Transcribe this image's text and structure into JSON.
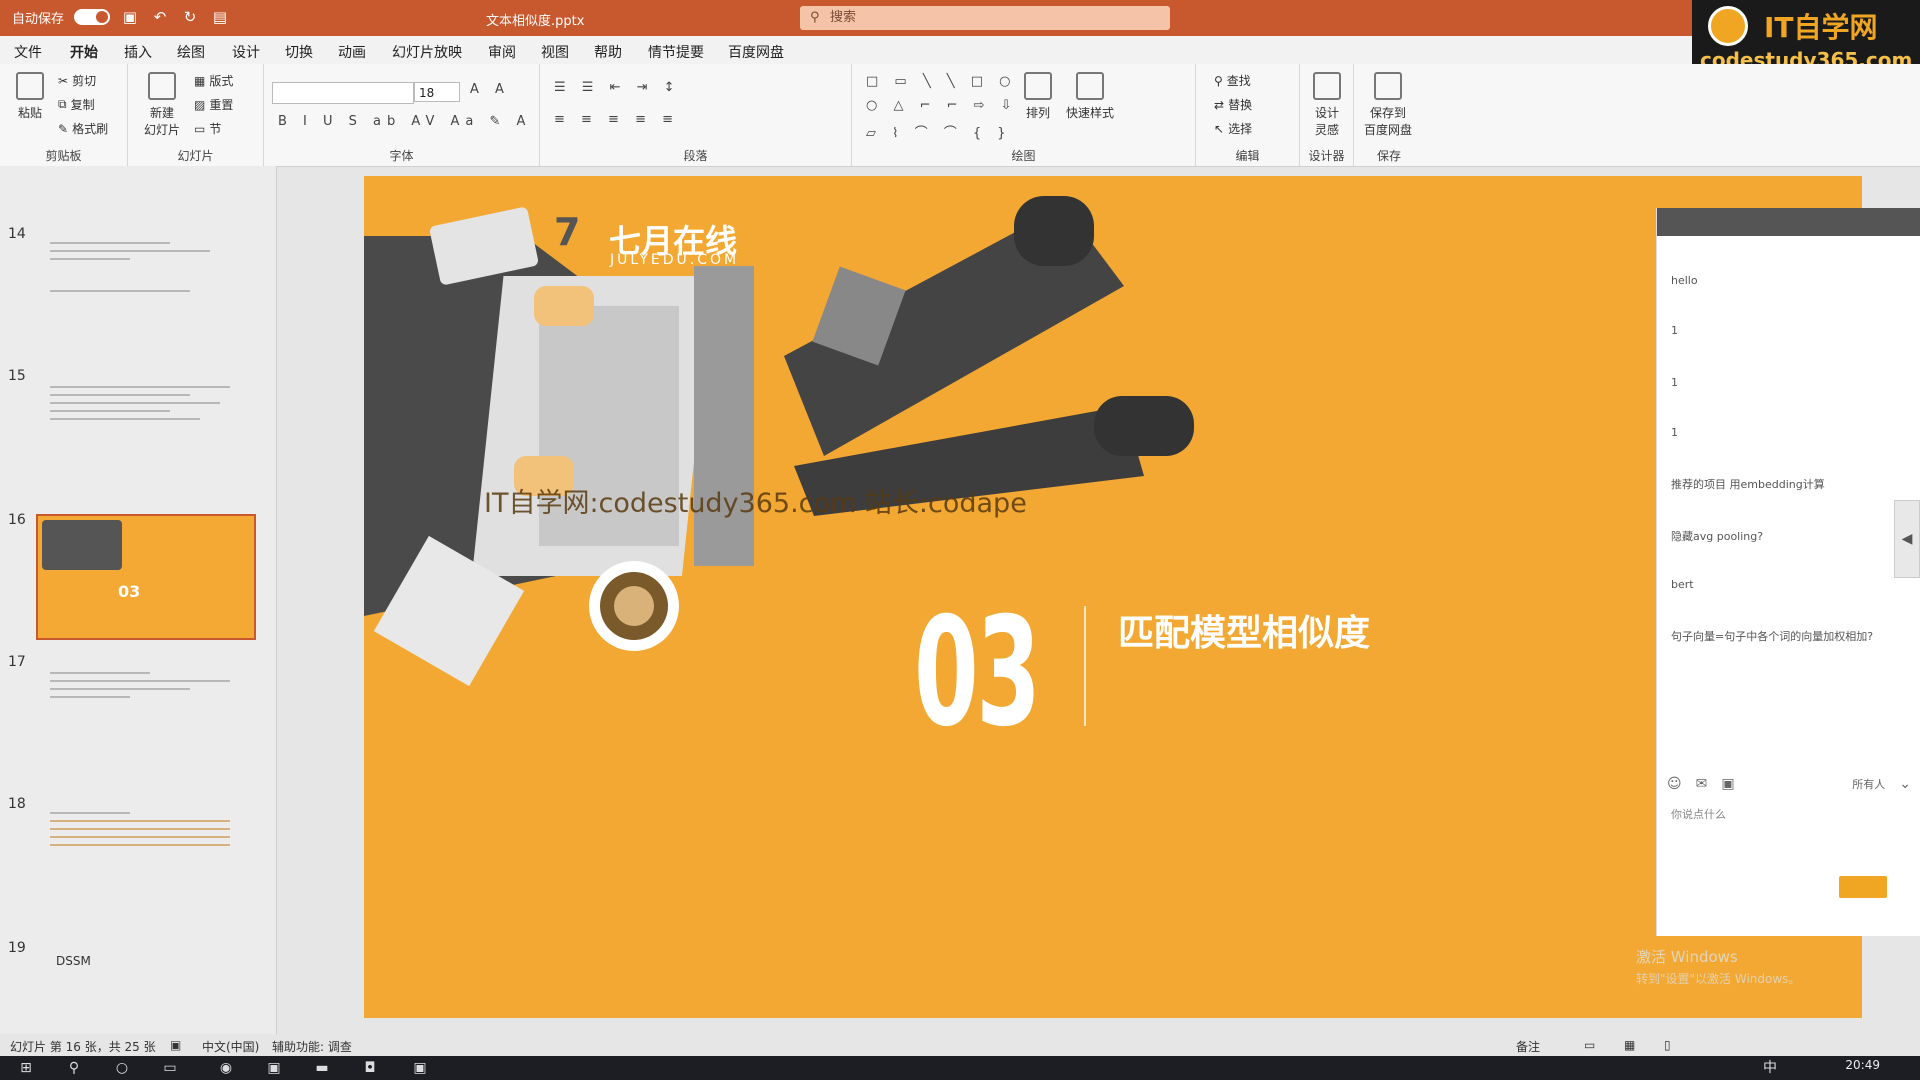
{
  "titlebar": {
    "autosave_label": "自动保存",
    "autosave_state": "关",
    "doc_title": "文本相似度.pptx",
    "search_placeholder": "搜索",
    "brand_title": "IT自学网",
    "brand_url": "codestudy365.com"
  },
  "menu": {
    "items": [
      "文件",
      "开始",
      "插入",
      "绘图",
      "设计",
      "切换",
      "动画",
      "幻灯片放映",
      "审阅",
      "视图",
      "帮助",
      "情节提要",
      "百度网盘"
    ],
    "active": "开始"
  },
  "ribbon": {
    "clipboard": {
      "paste": "粘贴",
      "cut": "剪切",
      "copy": "复制",
      "format_painter": "格式刷",
      "label": "剪贴板"
    },
    "slides": {
      "new_slide": "新建\n幻灯片",
      "layout": "版式",
      "reset": "重置",
      "section": "节",
      "label": "幻灯片"
    },
    "font": {
      "size": "18",
      "label": "字体"
    },
    "paragraph": {
      "label": "段落"
    },
    "drawing": {
      "arrange": "排列",
      "quick_styles": "快速样式",
      "label": "绘图"
    },
    "editing": {
      "find": "查找",
      "replace": "替换",
      "select": "选择",
      "label": "编辑"
    },
    "designer": {
      "design_ideas": "设计\n灵感",
      "label": "设计器"
    },
    "save": {
      "save_to_baidu": "保存到\n百度网盘",
      "label": "保存"
    }
  },
  "thumbnails": {
    "numbers": [
      "14",
      "15",
      "16",
      "17",
      "18",
      "19"
    ],
    "active_index": "16",
    "active_number_text": "03",
    "dssm_label": "DSSM"
  },
  "slide": {
    "logo_number": "7",
    "logo_cn": "七月在线",
    "logo_en": "JULYEDU.COM",
    "watermark": "IT自学网:codestudy365.com 站长:codape",
    "section_number": "03",
    "section_title": "匹配模型相似度"
  },
  "chat": {
    "messages": [
      {
        "meta": "",
        "text": "hello"
      },
      {
        "meta": "",
        "text": "1"
      },
      {
        "meta": "",
        "text": "1"
      },
      {
        "meta": "",
        "text": "1"
      },
      {
        "meta": "",
        "text": "推荐的项目 用embedding计算"
      },
      {
        "meta": "",
        "text": "隐藏avg pooling?"
      },
      {
        "meta": "",
        "text": "bert"
      },
      {
        "meta": "",
        "text": "句子向量=句子中各个词的向量加权相加?"
      }
    ],
    "audience": "所有人",
    "input_placeholder": "你说点什么"
  },
  "watermark_activate": {
    "line1": "激活 Windows",
    "line2": "转到\"设置\"以激活 Windows。"
  },
  "statusbar": {
    "slide_info": "幻灯片 第 16 张，共 25 张",
    "language": "中文(中国)",
    "accessibility": "辅助功能: 调查",
    "notes": "备注"
  },
  "taskbar": {
    "time": "20:49",
    "ime": "中"
  },
  "colors": {
    "accent": "#c8582e",
    "slide_bg": "#f2a832",
    "brand": "#f0a623"
  }
}
